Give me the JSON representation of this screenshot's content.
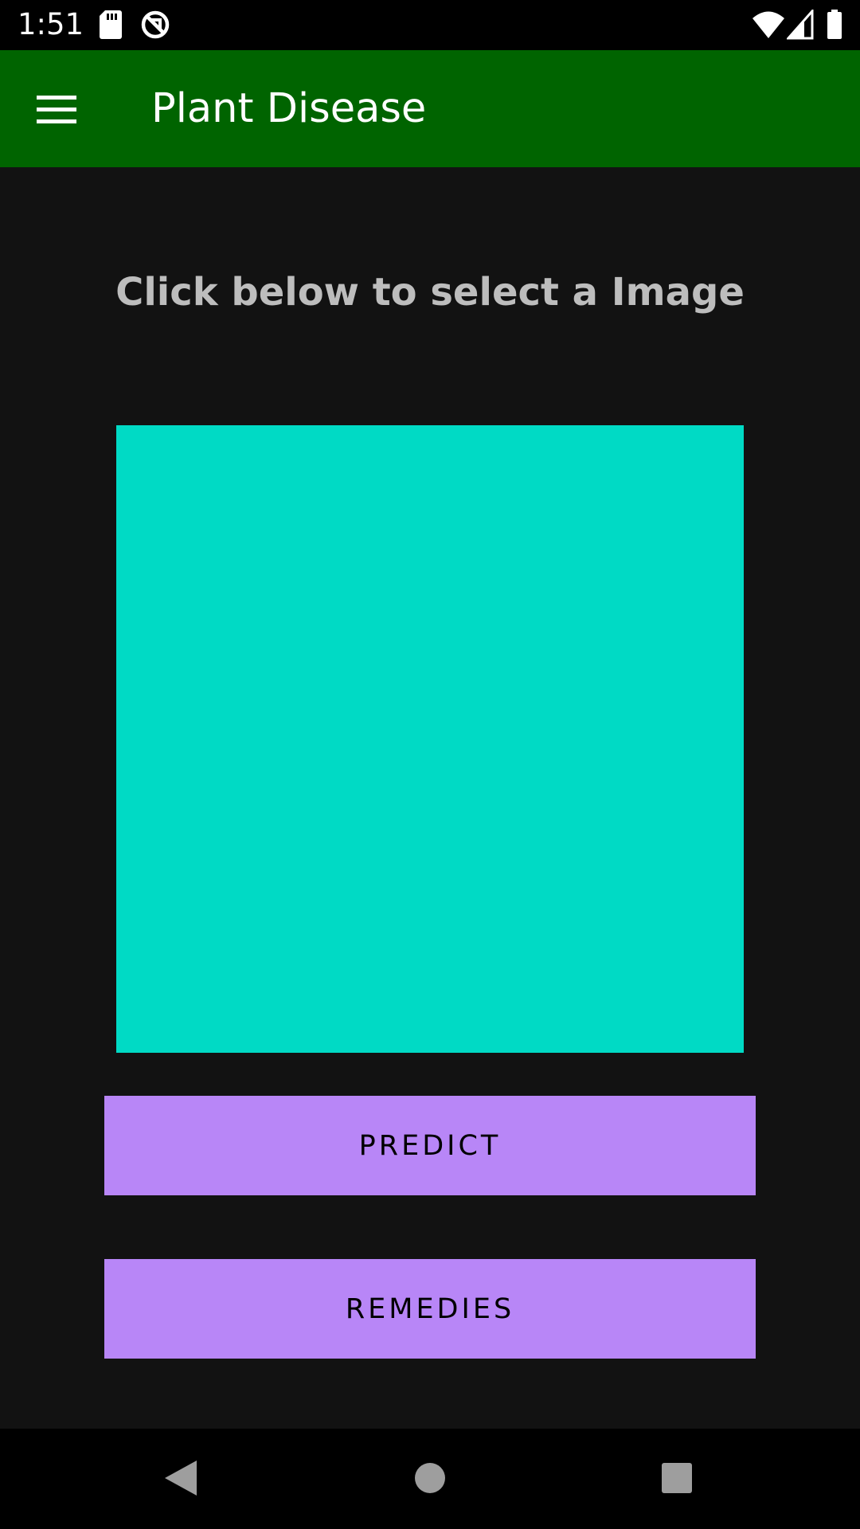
{
  "status_bar": {
    "time": "1:51",
    "icons": [
      "sd-card-icon",
      "sync-disabled-icon",
      "wifi-icon",
      "cellular-signal-icon",
      "battery-icon"
    ]
  },
  "app_bar": {
    "title": "Plant Disease",
    "menu_icon": "hamburger-menu-icon",
    "background_color": "#006400"
  },
  "main": {
    "instruction": "Click below to select a Image",
    "image_placeholder_color": "#00dac5",
    "predict_label": "PREDICT",
    "remedies_label": "REMEDIES",
    "button_color": "#b886f7"
  },
  "nav_bar": {
    "items": [
      "back-icon",
      "home-icon",
      "recents-icon"
    ]
  }
}
